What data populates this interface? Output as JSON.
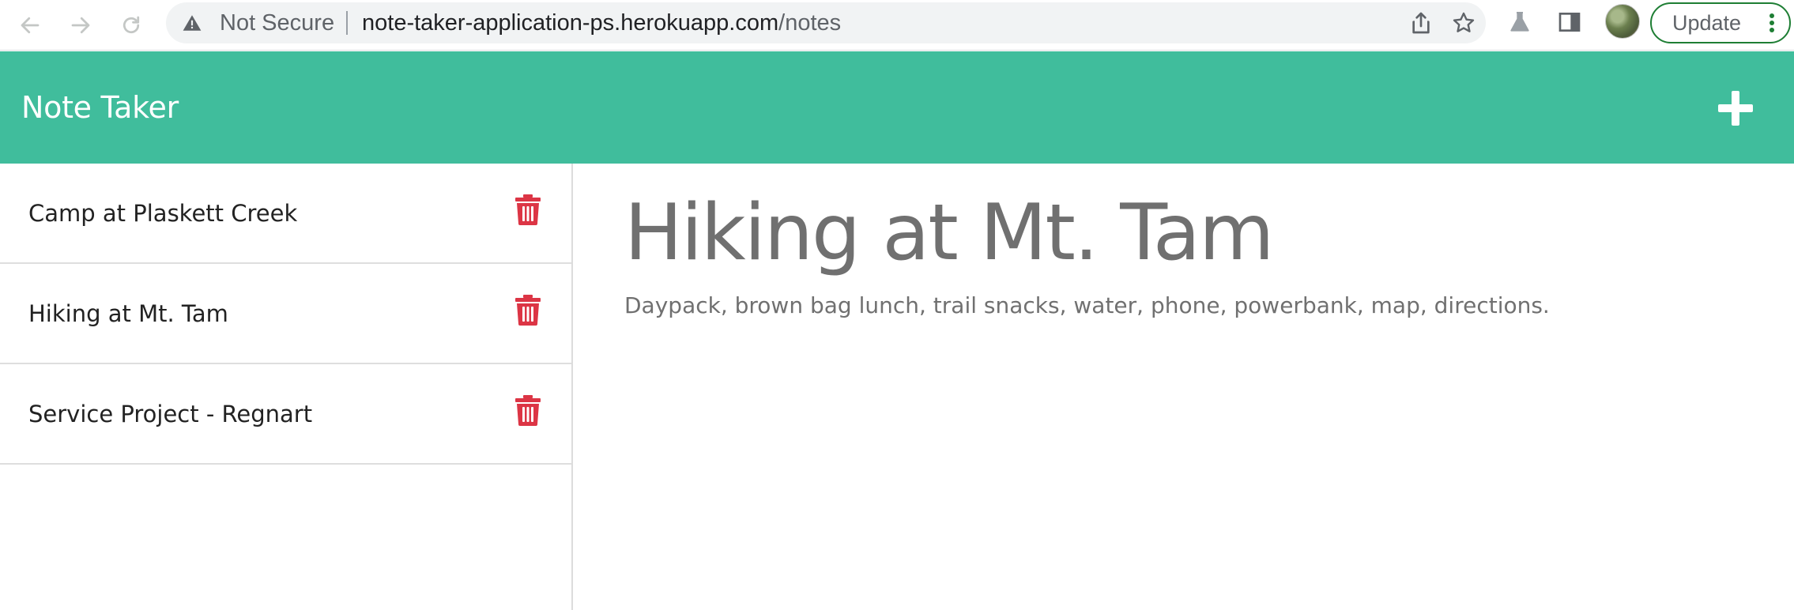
{
  "browser": {
    "security_label": "Not Secure",
    "url_host": "note-taker-application-ps.herokuapp.com",
    "url_path": "/notes",
    "update_label": "Update",
    "icons": {
      "back": "arrow-left-icon",
      "forward": "arrow-right-icon",
      "reload": "reload-icon",
      "warning": "warning-triangle-icon",
      "share": "share-icon",
      "bookmark": "star-icon",
      "labs": "flask-icon",
      "side_panel": "side-panel-icon",
      "menu": "kebab-menu-icon"
    }
  },
  "app": {
    "brand": "Note Taker",
    "add_icon": "plus-icon",
    "accent_color": "#40bd9c",
    "delete_color": "#dc3545"
  },
  "notes": [
    {
      "title": "Camp at Plaskett Creek"
    },
    {
      "title": "Hiking at Mt. Tam"
    },
    {
      "title": "Service Project - Regnart"
    }
  ],
  "active_note": {
    "title": "Hiking at Mt. Tam",
    "text": "Daypack, brown bag lunch, trail snacks, water, phone, powerbank, map, directions."
  }
}
